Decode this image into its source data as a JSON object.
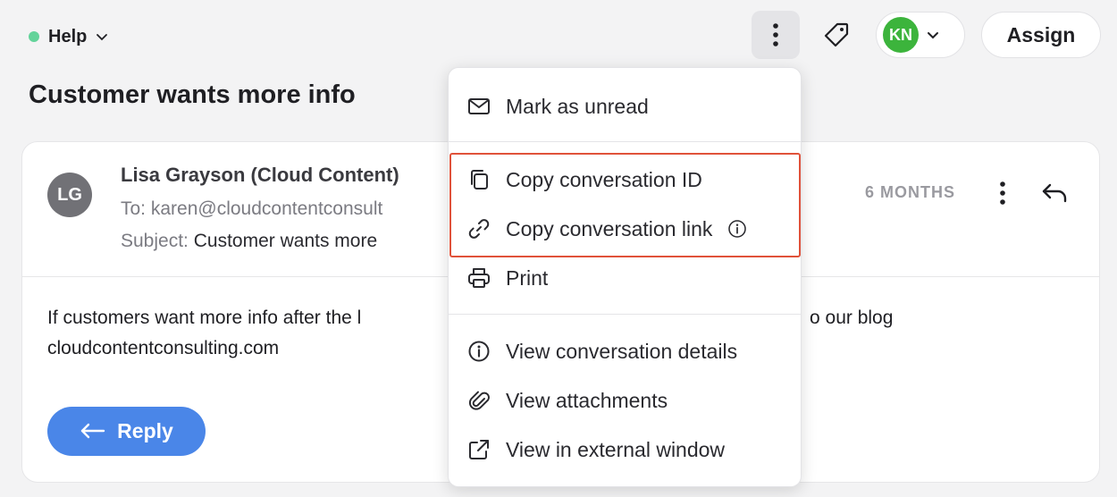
{
  "header": {
    "inbox_name": "Help",
    "assignee_initials": "KN",
    "assign_label": "Assign"
  },
  "conversation": {
    "title": "Customer wants more info"
  },
  "message": {
    "avatar_initials": "LG",
    "sender": "Lisa Grayson (Cloud Content)",
    "to_label": "To:",
    "to_value": "karen@cloudcontentconsult",
    "subject_label": "Subject:",
    "subject_value": "Customer wants more",
    "timestamp": "6 MONTHS",
    "body_line1": "If customers want more info after the l",
    "body_line1_tail": "o our blog",
    "body_line2": "cloudcontentconsulting.com",
    "reply_label": "Reply"
  },
  "menu": {
    "items": [
      {
        "label": "Mark as unread",
        "icon": "envelope-icon"
      },
      {
        "label": "Copy conversation ID",
        "icon": "copy-icon"
      },
      {
        "label": "Copy conversation link",
        "icon": "link-icon"
      },
      {
        "label": "Print",
        "icon": "printer-icon"
      },
      {
        "label": "View conversation details",
        "icon": "info-icon"
      },
      {
        "label": "View attachments",
        "icon": "paperclip-icon"
      },
      {
        "label": "View in external window",
        "icon": "external-link-icon"
      }
    ]
  },
  "colors": {
    "accent_blue": "#4a86e8",
    "status_green": "#63d39a",
    "avatar_green": "#3cb43c",
    "highlight_red": "#e0523a"
  }
}
